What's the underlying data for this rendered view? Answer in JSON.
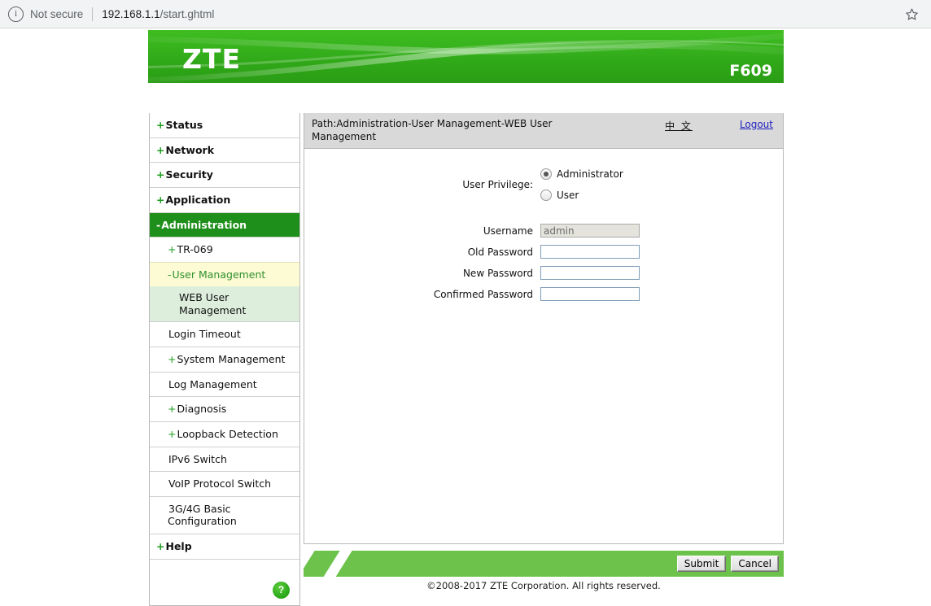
{
  "browser": {
    "security_label": "Not secure",
    "url_host": "192.168.1.1",
    "url_path": "/start.ghtml",
    "bookmark_icon": "star-icon",
    "info_icon": "info-circle-icon"
  },
  "header": {
    "brand": "ZTE",
    "model": "F609"
  },
  "sidebar": {
    "top_items": [
      {
        "sign": "+",
        "label": "Status",
        "active": false
      },
      {
        "sign": "+",
        "label": "Network",
        "active": false
      },
      {
        "sign": "+",
        "label": "Security",
        "active": false
      },
      {
        "sign": "+",
        "label": "Application",
        "active": false
      },
      {
        "sign": "-",
        "label": "Administration",
        "active": true
      }
    ],
    "sub_items": [
      {
        "sign": "+",
        "label": "TR-069",
        "state": "collapsed"
      },
      {
        "sign": "-",
        "label": "User Management",
        "state": "open"
      }
    ],
    "leaf_item": {
      "label": "WEB User Management",
      "selected": true
    },
    "after_items": [
      {
        "sign": "",
        "label": "Login Timeout"
      },
      {
        "sign": "+",
        "label": "System Management"
      },
      {
        "sign": "",
        "label": "Log Management"
      },
      {
        "sign": "+",
        "label": "Diagnosis"
      },
      {
        "sign": "+",
        "label": "Loopback Detection"
      },
      {
        "sign": "",
        "label": "IPv6 Switch"
      },
      {
        "sign": "",
        "label": "VoIP Protocol Switch"
      },
      {
        "sign": "",
        "label": "3G/4G Basic Configuration"
      }
    ],
    "help_top_item": {
      "sign": "+",
      "label": "Help"
    },
    "help_button": "?"
  },
  "content": {
    "path": "Path:Administration-User Management-WEB User Management",
    "lang_link": "中 文",
    "logout_link": "Logout",
    "privilege_label": "User Privilege:",
    "privilege_options": [
      {
        "label": "Administrator",
        "checked": true
      },
      {
        "label": "User",
        "checked": false
      }
    ],
    "fields": [
      {
        "label": "Username",
        "value": "admin",
        "disabled": true
      },
      {
        "label": "Old Password",
        "value": "",
        "disabled": false
      },
      {
        "label": "New Password",
        "value": "",
        "disabled": false
      },
      {
        "label": "Confirmed Password",
        "value": "",
        "disabled": false
      }
    ]
  },
  "footer": {
    "submit_label": "Submit",
    "cancel_label": "Cancel",
    "copyright": "©2008-2017 ZTE Corporation. All rights reserved."
  },
  "colors": {
    "brand_green": "#2ea517",
    "active_nav": "#1f8f1b",
    "footer_green": "#6cc24a",
    "open_nav": "#fcfbd3",
    "leaf_nav": "#ddeedd"
  }
}
